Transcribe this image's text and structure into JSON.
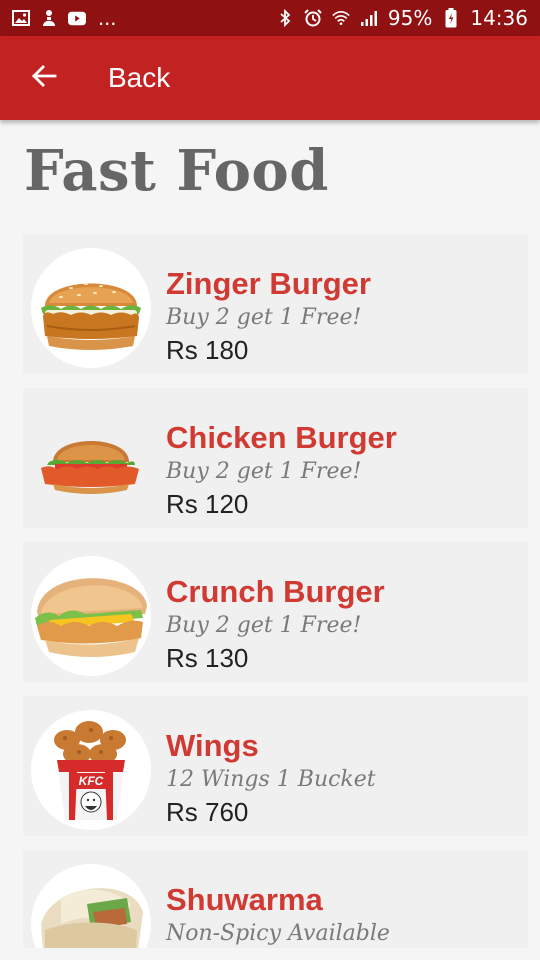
{
  "status_bar": {
    "left_icons": [
      "image-icon",
      "notification-icon",
      "youtube-icon"
    ],
    "overflow": "...",
    "right_icons": [
      "bluetooth-icon",
      "alarm-icon",
      "wifi-icon",
      "signal-icon"
    ],
    "battery": "95%",
    "time": "14:36"
  },
  "app_bar": {
    "back_icon": "arrow-left-icon",
    "back_label": "Back",
    "color": "#c22222"
  },
  "page": {
    "title": "Fast Food"
  },
  "menu_items": [
    {
      "name": "Zinger Burger",
      "offer": "Buy 2 get 1 Free!",
      "price": "Rs 180",
      "image": "zinger-burger-image"
    },
    {
      "name": "Chicken Burger",
      "offer": "Buy 2 get 1 Free!",
      "price": "Rs 120",
      "image": "chicken-burger-image"
    },
    {
      "name": "Crunch Burger",
      "offer": "Buy 2 get 1 Free!",
      "price": "Rs 130",
      "image": "crunch-burger-image"
    },
    {
      "name": "Wings",
      "offer": "12 Wings 1 Bucket",
      "price": "Rs 760",
      "image": "wings-bucket-image",
      "bucket_text": "KFC"
    },
    {
      "name": "Shuwarma",
      "offer": "Non-Spicy Available",
      "price": "",
      "image": "shuwarma-image"
    }
  ],
  "colors": {
    "status_bar": "#8f1111",
    "accent": "#d03a32",
    "title": "#666666",
    "card": "#f0f0f0"
  }
}
